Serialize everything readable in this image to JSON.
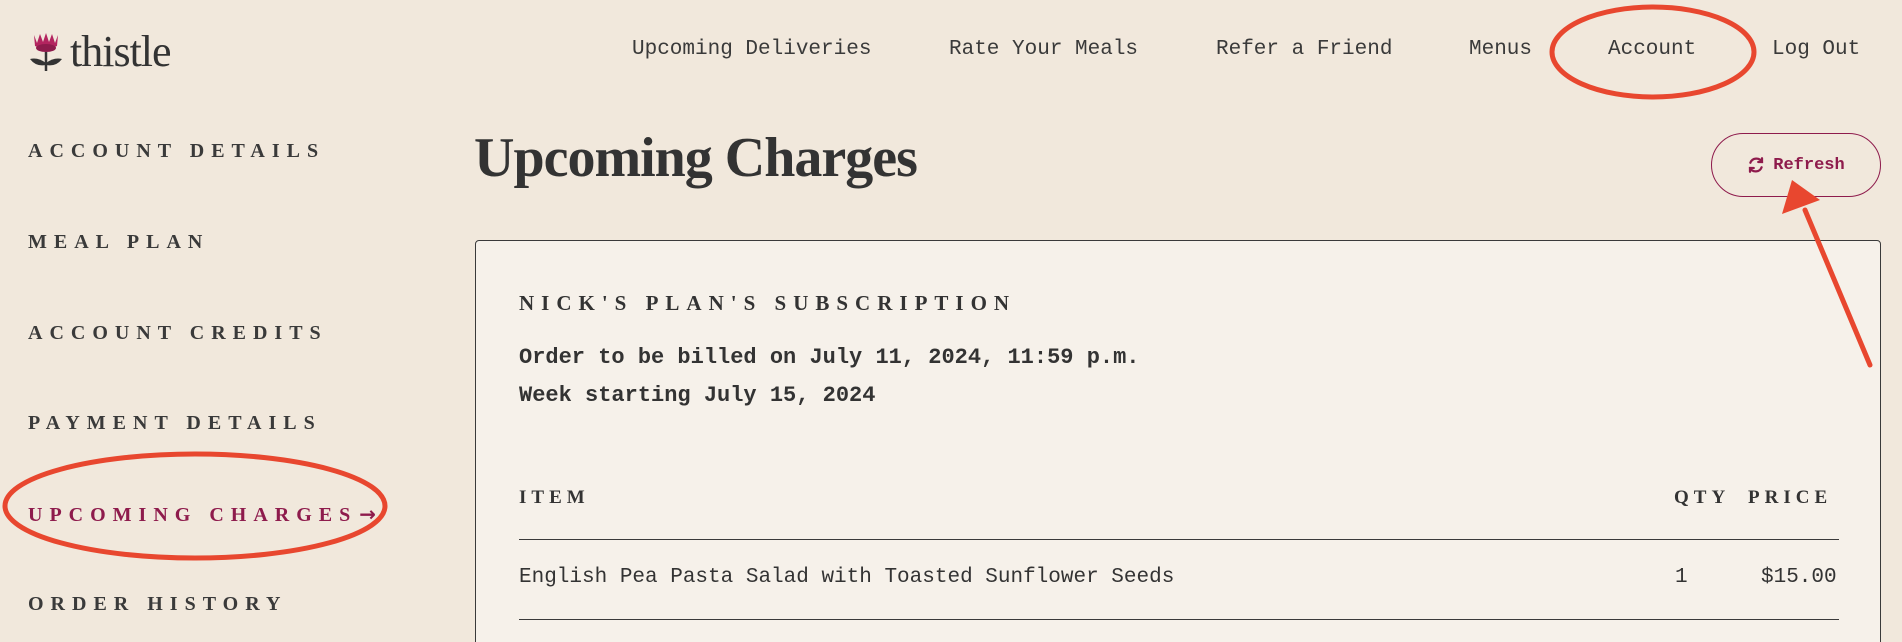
{
  "brand": {
    "name": "thistle",
    "accent": "#8e1b4c",
    "annotation_color": "#e8472f"
  },
  "topnav": {
    "items": [
      {
        "label": "Upcoming Deliveries"
      },
      {
        "label": "Rate Your Meals"
      },
      {
        "label": "Refer a Friend"
      },
      {
        "label": "Menus"
      },
      {
        "label": "Account"
      },
      {
        "label": "Log Out"
      }
    ]
  },
  "sidebar": {
    "items": [
      {
        "label": "ACCOUNT DETAILS"
      },
      {
        "label": "MEAL PLAN"
      },
      {
        "label": "ACCOUNT CREDITS"
      },
      {
        "label": "PAYMENT DETAILS"
      },
      {
        "label": "UPCOMING CHARGES",
        "active": true,
        "arrow": "→"
      },
      {
        "label": "ORDER HISTORY"
      }
    ]
  },
  "main": {
    "title": "Upcoming Charges",
    "refresh_label": "Refresh",
    "refresh_icon": "refresh-icon"
  },
  "subscription": {
    "title": "NICK'S PLAN'S SUBSCRIPTION",
    "billed_line": "Order to be billed on July 11, 2024, 11:59 p.m.",
    "week_line": "Week starting July 15, 2024",
    "columns": {
      "item": "ITEM",
      "qty": "QTY",
      "price": "PRICE"
    },
    "rows": [
      {
        "item": "English Pea Pasta Salad with Toasted Sunflower Seeds",
        "qty": "1",
        "price": "$15.00"
      }
    ]
  }
}
